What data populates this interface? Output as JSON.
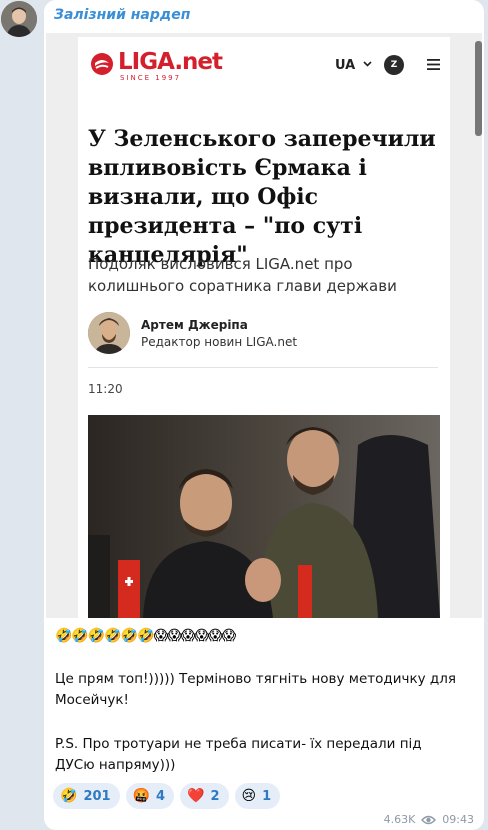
{
  "channel": {
    "name": "Залізний нардеп"
  },
  "article": {
    "logo_text": "LIGA.net",
    "logo_since": "SINCE 1997",
    "lang": "UA",
    "account_initial": "Z",
    "headline": "У Зеленського заперечили впливовість Єрмака і визнали, що Офіс президента – \"по суті канцелярія\"",
    "subheadline": "Подоляк висловився LIGA.net про колишнього соратника глави держави",
    "author_name": "Артем Джеріпа",
    "author_role": "Редактор новин LIGA.net",
    "time": "11:20"
  },
  "message": {
    "emoji_line": "🤣🤣🤣🤣🤣🤣😱😱😱😱😱😱",
    "paragraph1": "Це прям топ!))))) Терміново тягніть нову методичку для Мосейчук!",
    "paragraph2": "P.S. Про тротуари не треба писати- їх передали під ДУСю напряму)))"
  },
  "reactions": [
    {
      "emoji": "🤣",
      "count": "201"
    },
    {
      "emoji": "🤬",
      "count": "4"
    },
    {
      "emoji": "❤️",
      "count": "2"
    },
    {
      "emoji": "😢",
      "count": "1"
    }
  ],
  "meta": {
    "views": "4.63K",
    "time": "09:43"
  },
  "colors": {
    "accent": "#3a8fd6",
    "brand": "#d4202c",
    "reaction_bg": "#e5eef8"
  }
}
